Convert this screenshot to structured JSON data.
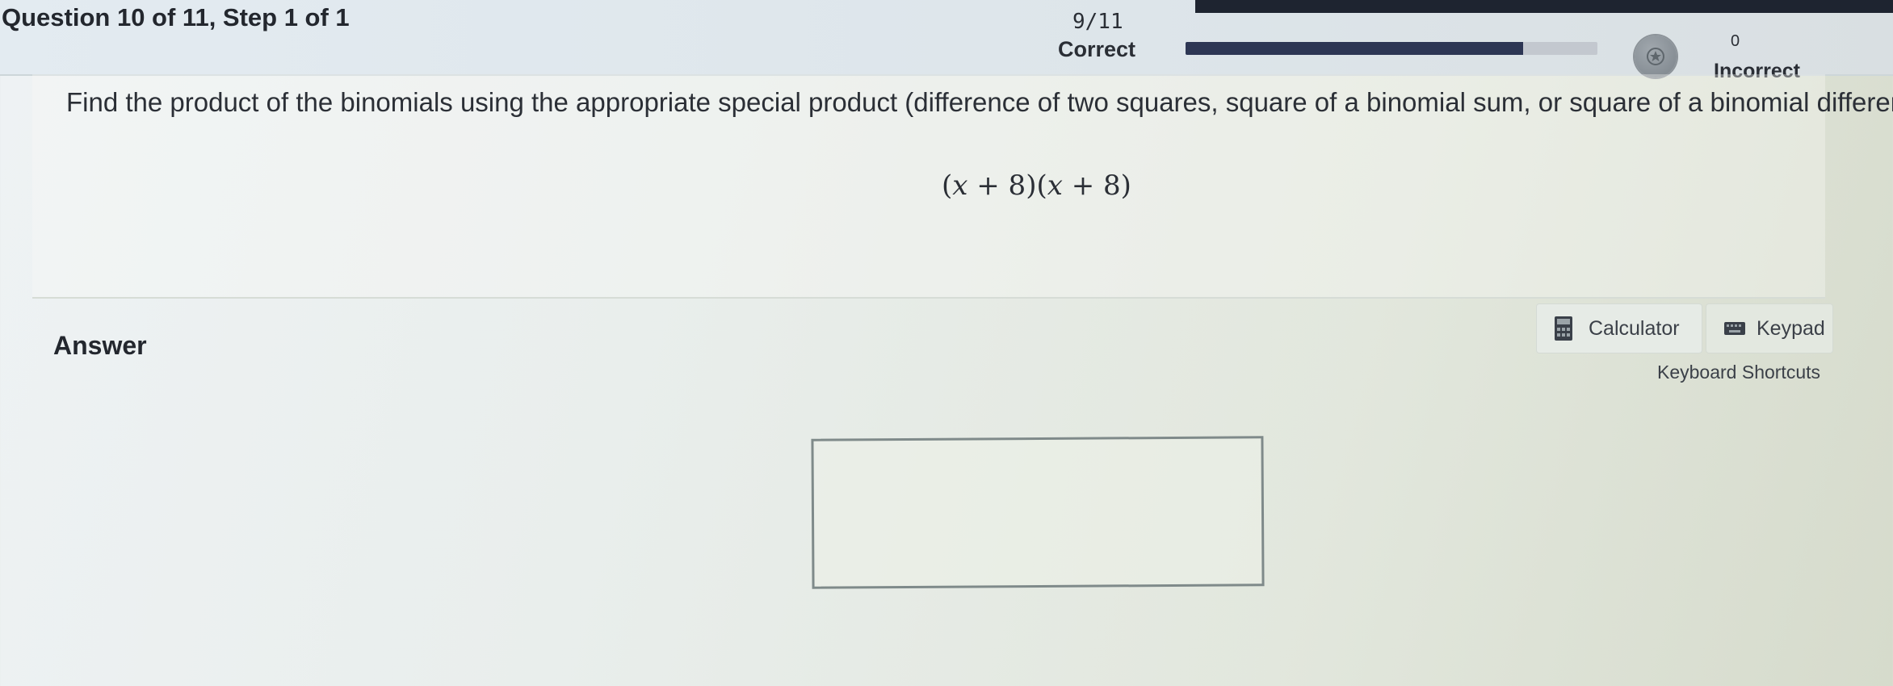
{
  "header": {
    "question_label": "Question 10 of 11,  Step 1 of 1",
    "score_fraction": "9/11",
    "correct_label": "Correct",
    "progress_fraction": 0.82,
    "incorrect_count": "0",
    "incorrect_label": "Incorrect"
  },
  "question": {
    "prompt": "Find the product of the binomials using the appropriate special product (difference of two squares, square of a binomial sum, or square of a binomial difference).",
    "expression": {
      "open1": "(",
      "var1": "x",
      "op1": " + 8)(",
      "var2": "x",
      "op2": " + 8)"
    }
  },
  "answer": {
    "label": "Answer",
    "value": "",
    "calculator_label": "Calculator",
    "keypad_label": "Keypad",
    "shortcuts_label": "Keyboard Shortcuts"
  },
  "colors": {
    "progress_fill": "#2d3654",
    "progress_track": "#c3c8cf",
    "text": "#2b2f36"
  },
  "icons": {
    "calculator": "calculator-icon",
    "keypad": "keyboard-icon",
    "medal": "medal-icon"
  }
}
